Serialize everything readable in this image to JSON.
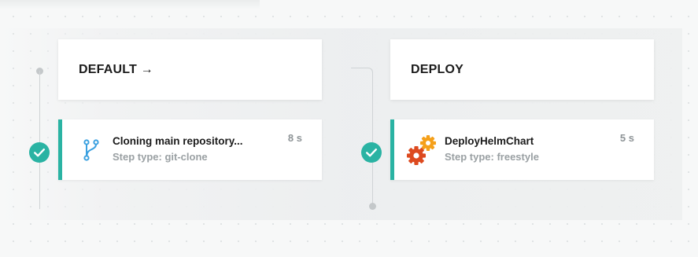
{
  "pipeline": {
    "stages": [
      {
        "name": "DEFAULT →",
        "steps": [
          {
            "title": "Cloning main repository...",
            "step_type": "Step type: git-clone",
            "duration": "8 s",
            "status": "success",
            "icon": "git-branch-icon"
          }
        ]
      },
      {
        "name": "DEPLOY",
        "steps": [
          {
            "title": "DeployHelmChart",
            "step_type": "Step type: freestyle",
            "duration": "5 s",
            "status": "success",
            "icon": "gears-icon"
          }
        ]
      }
    ]
  },
  "colors": {
    "success": "#2ab3a3",
    "git_icon": "#3aa0e0",
    "gear_orange": "#f5a01a",
    "gear_red": "#dd4a1f"
  }
}
